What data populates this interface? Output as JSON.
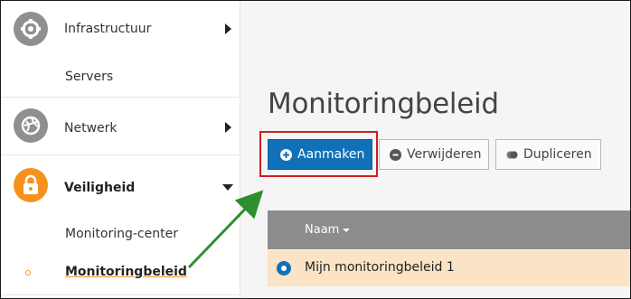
{
  "sidebar": {
    "items": [
      {
        "label": "Infrastructuur",
        "icon": "gear-icon"
      },
      {
        "label": "Servers"
      },
      {
        "label": "Netwerk",
        "icon": "globe-icon"
      },
      {
        "label": "Veiligheid",
        "icon": "lock-icon"
      },
      {
        "label": "Monitoring-center"
      },
      {
        "label": "Monitoringbeleid"
      }
    ]
  },
  "main": {
    "title": "Monitoringbeleid",
    "toolbar": {
      "create_label": "Aanmaken",
      "delete_label": "Verwijderen",
      "duplicate_label": "Dupliceren"
    },
    "table": {
      "columns": [
        "Naam"
      ],
      "rows": [
        {
          "name": "Mijn monitoringbeleid 1",
          "selected": true
        }
      ]
    }
  },
  "colors": {
    "primary": "#1171b8",
    "accent_orange": "#f5921e",
    "row_selected": "#fbe3c6",
    "table_header": "#8c8c8c",
    "highlight_red": "#cc1f1f",
    "annotation_arrow": "#2f8f2f"
  }
}
